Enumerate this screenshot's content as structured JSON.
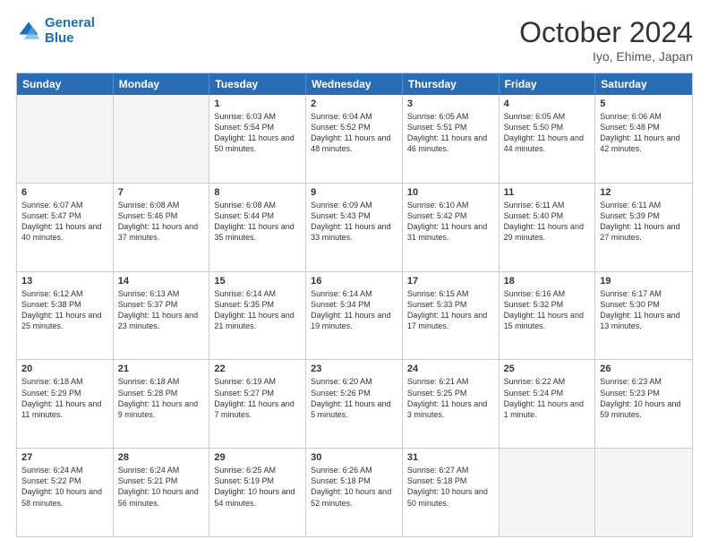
{
  "header": {
    "logo_line1": "General",
    "logo_line2": "Blue",
    "month_title": "October 2024",
    "location": "Iyo, Ehime, Japan"
  },
  "weekdays": [
    "Sunday",
    "Monday",
    "Tuesday",
    "Wednesday",
    "Thursday",
    "Friday",
    "Saturday"
  ],
  "weeks": [
    [
      {
        "day": "",
        "empty": true
      },
      {
        "day": "",
        "empty": true
      },
      {
        "day": "1",
        "sunrise": "6:03 AM",
        "sunset": "5:54 PM",
        "daylight": "11 hours and 50 minutes."
      },
      {
        "day": "2",
        "sunrise": "6:04 AM",
        "sunset": "5:52 PM",
        "daylight": "11 hours and 48 minutes."
      },
      {
        "day": "3",
        "sunrise": "6:05 AM",
        "sunset": "5:51 PM",
        "daylight": "11 hours and 46 minutes."
      },
      {
        "day": "4",
        "sunrise": "6:05 AM",
        "sunset": "5:50 PM",
        "daylight": "11 hours and 44 minutes."
      },
      {
        "day": "5",
        "sunrise": "6:06 AM",
        "sunset": "5:48 PM",
        "daylight": "11 hours and 42 minutes."
      }
    ],
    [
      {
        "day": "6",
        "sunrise": "6:07 AM",
        "sunset": "5:47 PM",
        "daylight": "11 hours and 40 minutes."
      },
      {
        "day": "7",
        "sunrise": "6:08 AM",
        "sunset": "5:46 PM",
        "daylight": "11 hours and 37 minutes."
      },
      {
        "day": "8",
        "sunrise": "6:08 AM",
        "sunset": "5:44 PM",
        "daylight": "11 hours and 35 minutes."
      },
      {
        "day": "9",
        "sunrise": "6:09 AM",
        "sunset": "5:43 PM",
        "daylight": "11 hours and 33 minutes."
      },
      {
        "day": "10",
        "sunrise": "6:10 AM",
        "sunset": "5:42 PM",
        "daylight": "11 hours and 31 minutes."
      },
      {
        "day": "11",
        "sunrise": "6:11 AM",
        "sunset": "5:40 PM",
        "daylight": "11 hours and 29 minutes."
      },
      {
        "day": "12",
        "sunrise": "6:11 AM",
        "sunset": "5:39 PM",
        "daylight": "11 hours and 27 minutes."
      }
    ],
    [
      {
        "day": "13",
        "sunrise": "6:12 AM",
        "sunset": "5:38 PM",
        "daylight": "11 hours and 25 minutes."
      },
      {
        "day": "14",
        "sunrise": "6:13 AM",
        "sunset": "5:37 PM",
        "daylight": "11 hours and 23 minutes."
      },
      {
        "day": "15",
        "sunrise": "6:14 AM",
        "sunset": "5:35 PM",
        "daylight": "11 hours and 21 minutes."
      },
      {
        "day": "16",
        "sunrise": "6:14 AM",
        "sunset": "5:34 PM",
        "daylight": "11 hours and 19 minutes."
      },
      {
        "day": "17",
        "sunrise": "6:15 AM",
        "sunset": "5:33 PM",
        "daylight": "11 hours and 17 minutes."
      },
      {
        "day": "18",
        "sunrise": "6:16 AM",
        "sunset": "5:32 PM",
        "daylight": "11 hours and 15 minutes."
      },
      {
        "day": "19",
        "sunrise": "6:17 AM",
        "sunset": "5:30 PM",
        "daylight": "11 hours and 13 minutes."
      }
    ],
    [
      {
        "day": "20",
        "sunrise": "6:18 AM",
        "sunset": "5:29 PM",
        "daylight": "11 hours and 11 minutes."
      },
      {
        "day": "21",
        "sunrise": "6:18 AM",
        "sunset": "5:28 PM",
        "daylight": "11 hours and 9 minutes."
      },
      {
        "day": "22",
        "sunrise": "6:19 AM",
        "sunset": "5:27 PM",
        "daylight": "11 hours and 7 minutes."
      },
      {
        "day": "23",
        "sunrise": "6:20 AM",
        "sunset": "5:26 PM",
        "daylight": "11 hours and 5 minutes."
      },
      {
        "day": "24",
        "sunrise": "6:21 AM",
        "sunset": "5:25 PM",
        "daylight": "11 hours and 3 minutes."
      },
      {
        "day": "25",
        "sunrise": "6:22 AM",
        "sunset": "5:24 PM",
        "daylight": "11 hours and 1 minute."
      },
      {
        "day": "26",
        "sunrise": "6:23 AM",
        "sunset": "5:23 PM",
        "daylight": "10 hours and 59 minutes."
      }
    ],
    [
      {
        "day": "27",
        "sunrise": "6:24 AM",
        "sunset": "5:22 PM",
        "daylight": "10 hours and 58 minutes."
      },
      {
        "day": "28",
        "sunrise": "6:24 AM",
        "sunset": "5:21 PM",
        "daylight": "10 hours and 56 minutes."
      },
      {
        "day": "29",
        "sunrise": "6:25 AM",
        "sunset": "5:19 PM",
        "daylight": "10 hours and 54 minutes."
      },
      {
        "day": "30",
        "sunrise": "6:26 AM",
        "sunset": "5:18 PM",
        "daylight": "10 hours and 52 minutes."
      },
      {
        "day": "31",
        "sunrise": "6:27 AM",
        "sunset": "5:18 PM",
        "daylight": "10 hours and 50 minutes."
      },
      {
        "day": "",
        "empty": true
      },
      {
        "day": "",
        "empty": true
      }
    ]
  ]
}
